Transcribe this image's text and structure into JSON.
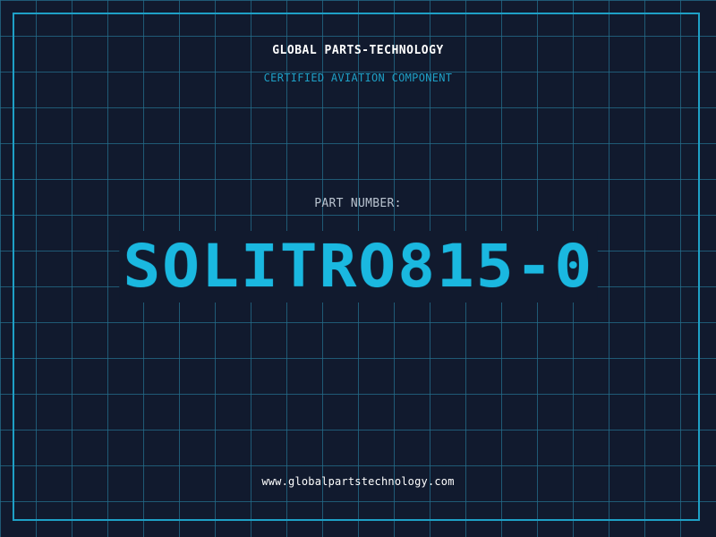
{
  "header": {
    "company": "GLOBAL PARTS-TECHNOLOGY",
    "subtitle": "CERTIFIED AVIATION COMPONENT"
  },
  "part": {
    "label": "PART NUMBER:",
    "number": "SOLITRO815-0"
  },
  "footer": {
    "website": "www.globalpartstechnology.com"
  },
  "colors": {
    "background": "#111a2e",
    "grid": "#246e8c",
    "accent": "#1ea0c6",
    "part_number": "#1ab8e0",
    "white_text": "#ffffff",
    "muted_text": "#b9c3cf"
  }
}
